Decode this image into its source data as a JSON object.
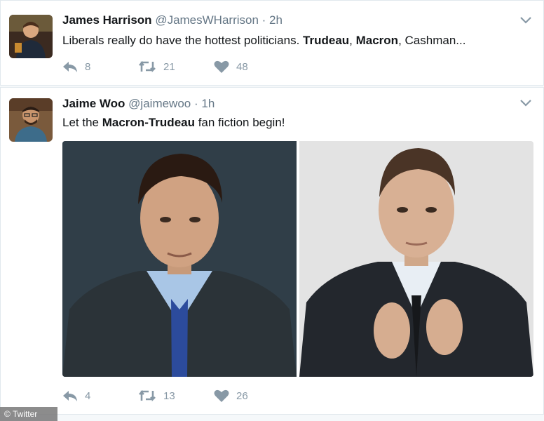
{
  "tweets": [
    {
      "name": "James Harrison",
      "handle": "@JamesWHarrison",
      "sep": " · ",
      "time": "2h",
      "text_parts": {
        "a": "Liberals really do have the hottest politicians. ",
        "b": "Trudeau",
        "c": ", ",
        "d": "Macron",
        "e": ", Cashman..."
      },
      "replies": "8",
      "retweets": "21",
      "likes": "48"
    },
    {
      "name": "Jaime Woo",
      "handle": "@jaimewoo",
      "sep": " · ",
      "time": "1h",
      "text_parts": {
        "a": "Let the ",
        "b": "Macron",
        "c": "-",
        "d": "Trudeau",
        "e": " fan fiction begin!"
      },
      "replies": "4",
      "retweets": "13",
      "likes": "26"
    }
  ],
  "watermark": "© Twitter",
  "icons": {
    "reply": "reply-icon",
    "retweet": "retweet-icon",
    "like": "heart-icon",
    "caret": "chevron-down-icon"
  },
  "colors": {
    "action_gray": "#8899a6",
    "meta_gray": "#657786",
    "border": "#e1e8ed"
  }
}
